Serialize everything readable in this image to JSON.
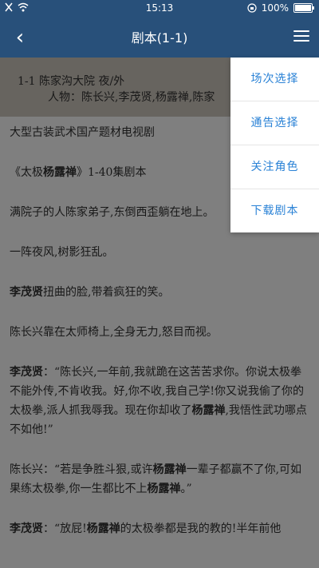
{
  "status_bar": {
    "time": "15:13",
    "battery": "100%",
    "battery_level": 1.0
  },
  "nav": {
    "back_icon": "chevron-left",
    "title": "剧本(1-1)",
    "menu_icon": "hamburger"
  },
  "scene": {
    "heading": "1-1 陈家沟大院 夜/外",
    "people": "人物：陈长兴,李茂贤,杨露禅,陈家"
  },
  "script_lines": [
    [
      {
        "t": "大型古装武术国产题材电视剧",
        "b": false
      }
    ],
    [
      {
        "t": "《太极",
        "b": false
      },
      {
        "t": "杨露禅",
        "b": true
      },
      {
        "t": "》1-40集剧本",
        "b": false
      }
    ],
    [
      {
        "t": "满院子的人陈家弟子,东倒西歪躺在地上。",
        "b": false
      }
    ],
    [
      {
        "t": "一阵夜风,树影狂乱。",
        "b": false
      }
    ],
    [
      {
        "t": "李茂贤",
        "b": true
      },
      {
        "t": "扭曲的脸,带着疯狂的笑。",
        "b": false
      }
    ],
    [
      {
        "t": "陈长兴靠在太师椅上,全身无力,怒目而视。",
        "b": false
      }
    ],
    [
      {
        "t": "李茂贤",
        "b": true
      },
      {
        "t": "：“陈长兴,一年前,我就跪在这苦苦求你。你说太极拳不能外传,不肯收我。好,你不收,我自己学!你又说我偷了你的太极拳,派人抓我辱我。现在你却收了",
        "b": false
      },
      {
        "t": "杨露禅",
        "b": true
      },
      {
        "t": ",我悟性武功哪点不如他!”",
        "b": false
      }
    ],
    [
      {
        "t": "陈长兴：“若是争胜斗狠,或许",
        "b": false
      },
      {
        "t": "杨露禅",
        "b": true
      },
      {
        "t": "一辈子都赢不了你,可如果练太极拳,你一生都比不上",
        "b": false
      },
      {
        "t": "杨露禅",
        "b": true
      },
      {
        "t": "。”",
        "b": false
      }
    ],
    [
      {
        "t": "李茂贤",
        "b": true
      },
      {
        "t": "：“放屁!",
        "b": false
      },
      {
        "t": "杨露禅",
        "b": true
      },
      {
        "t": "的太极拳都是我的教的!半年前他",
        "b": false
      }
    ]
  ],
  "menu": {
    "items": [
      "场次选择",
      "通告选择",
      "关注角色",
      "下载剧本"
    ]
  }
}
